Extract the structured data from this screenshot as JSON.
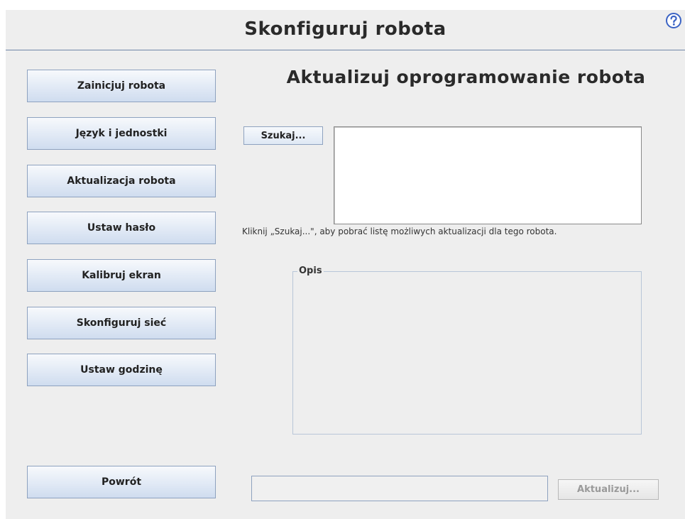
{
  "header": {
    "title": "Skonfiguruj robota",
    "help_icon": "question-mark-icon"
  },
  "sidebar": {
    "items": [
      {
        "label": "Zainicjuj robota"
      },
      {
        "label": "Język i jednostki"
      },
      {
        "label": "Aktualizacja robota"
      },
      {
        "label": "Ustaw hasło"
      },
      {
        "label": "Kalibruj ekran"
      },
      {
        "label": "Skonfiguruj sieć"
      },
      {
        "label": "Ustaw godzinę"
      }
    ],
    "back_label": "Powrót"
  },
  "main": {
    "title": "Aktualizuj oprogramowanie robota",
    "search_label": "Szukaj...",
    "update_list_items": [],
    "hint": "Kliknij „Szukaj...\", aby pobrać listę możliwych aktualizacji dla tego robota.",
    "description_label": "Opis",
    "description_text": "",
    "progress_text": "",
    "update_label": "Aktualizuj..."
  },
  "colors": {
    "background": "#eeeeee",
    "button_border": "#8ea2bf",
    "button_gradient_bottom": "#cfdcef",
    "header_rule": "#6f86a8",
    "help_icon": "#3b63c4",
    "disabled_text": "#9a9a9a"
  }
}
